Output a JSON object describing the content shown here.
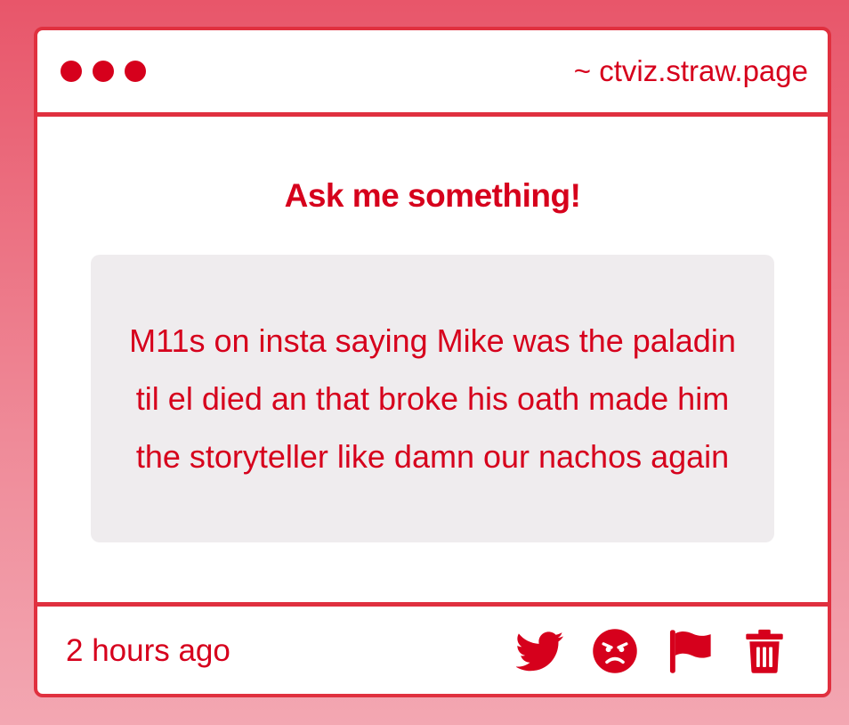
{
  "window": {
    "url": "~ ctviz.straw.page"
  },
  "main": {
    "heading": "Ask me something!",
    "question": "M11s on insta saying Mike was the paladin til el died an that broke his oath made him the storyteller like damn our nachos again"
  },
  "footer": {
    "timestamp": "2 hours ago",
    "actions": [
      {
        "icon": "twitter-icon"
      },
      {
        "icon": "angry-face-icon"
      },
      {
        "icon": "flag-icon"
      },
      {
        "icon": "trash-icon"
      }
    ]
  },
  "colors": {
    "accent": "#d6001c",
    "border": "#e0303f",
    "bubble": "#efecee"
  }
}
